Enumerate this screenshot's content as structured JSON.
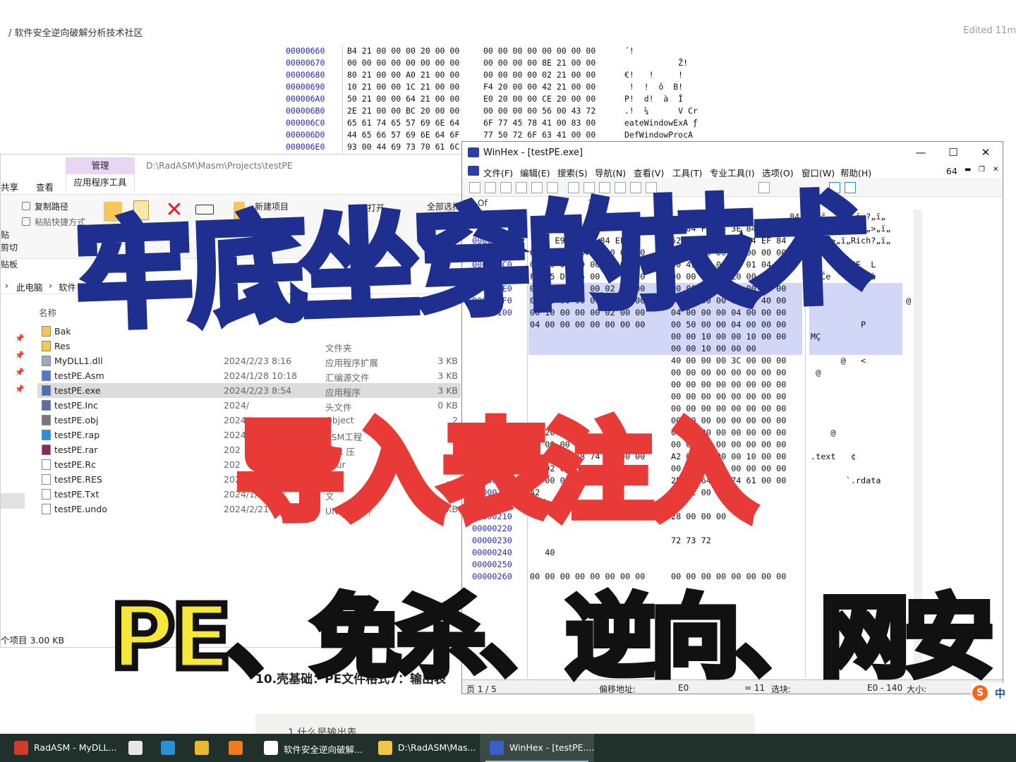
{
  "notion": {
    "breadcrumb": "/  软件安全逆向破解分析技术社区",
    "edited": "Edited 11m",
    "heading": "10.壳基础：PE文件格式7：输出表",
    "block_text": "1.什么是输出表",
    "hex_rows": [
      {
        "off": "00000660",
        "b1": "B4 21 00 00 00 20 00 00",
        "b2": "00 00 00 00 00 00 00 00",
        "asc": "´!"
      },
      {
        "off": "00000670",
        "b1": "00 00 00 00 00 00 00 00",
        "b2": "00 00 00 00 8E 21 00 00",
        "asc": "           Ž!"
      },
      {
        "off": "00000680",
        "b1": "80 21 00 00 A0 21 00 00",
        "b2": "00 00 00 00 02 21 00 00",
        "asc": "€!   !     !"
      },
      {
        "off": "00000690",
        "b1": "10 21 00 00 1C 21 00 00",
        "b2": "F4 20 00 00 42 21 00 00",
        "asc": " !  !  ô  B!"
      },
      {
        "off": "000006A0",
        "b1": "50 21 00 00 64 21 00 00",
        "b2": "E0 20 00 00 CE 20 00 00",
        "asc": "P!  d!  à  Î"
      },
      {
        "off": "000006B0",
        "b1": "2E 21 00 00 BC 20 00 00",
        "b2": "00 00 00 00 56 00 43 72",
        "asc": ".!  ¼      V Cr"
      },
      {
        "off": "000006C0",
        "b1": "65 61 74 65 57 69 6E 64",
        "b2": "6F 77 45 78 41 00 83 00",
        "asc": "eateWindowExA ƒ"
      },
      {
        "off": "000006D0",
        "b1": "44 65 66 57 69 6E 64 6F",
        "b2": "77 50 72 6F 63 41 00 00",
        "asc": "DefWindowProcA"
      },
      {
        "off": "000006E0",
        "b1": "93 00 44 69 73 70 61 6C",
        "b2": "",
        "asc": ""
      }
    ]
  },
  "explorer": {
    "manage_tab": "管理",
    "apptools_tab": "应用程序工具",
    "path_title": "D:\\RadASM\\Masm\\Projects\\testPE",
    "share_tab": "共享",
    "view_tab": "查看",
    "copy_path": "复制路径",
    "paste_shortcut": "粘贴快捷方式",
    "new_item": "新建项目",
    "move_to": "移动",
    "open_label": "打开",
    "select_all": "全部选择",
    "paste_partial": "贴",
    "cut_partial": "剪切",
    "clipboard_partial": "贴板",
    "addr_pc": "此电脑",
    "addr_soft": "软件",
    "col_name": "名称",
    "status": "个项目   3.00 KB",
    "files": [
      {
        "name": "Bak",
        "date": "",
        "type": "",
        "size": "",
        "icon": "folder",
        "sel": false
      },
      {
        "name": "Res",
        "date": "",
        "type": "文件夹",
        "size": "",
        "icon": "folder",
        "sel": false
      },
      {
        "name": "MyDLL1.dll",
        "date": "2024/2/23 8:16",
        "type": "应用程序扩展",
        "size": "3 KB",
        "icon": "dll",
        "sel": false
      },
      {
        "name": "testPE.Asm",
        "date": "2024/1/28 10:18",
        "type": "汇编源文件",
        "size": "3 KB",
        "icon": "asm",
        "sel": false
      },
      {
        "name": "testPE.exe",
        "date": "2024/2/23 8:54",
        "type": "应用程序",
        "size": "3 KB",
        "icon": "exe",
        "sel": true
      },
      {
        "name": "testPE.Inc",
        "date": "2024/",
        "type": "头文件",
        "size": "0 KB",
        "icon": "inc",
        "sel": false
      },
      {
        "name": "testPE.obj",
        "date": "2024/",
        "type": "Object",
        "size": "2",
        "icon": "obj",
        "sel": false
      },
      {
        "name": "testPE.rap",
        "date": "2024/",
        "type": "ASM工程",
        "size": "2",
        "icon": "rap",
        "sel": false
      },
      {
        "name": "testPE.rar",
        "date": "202",
        "type": "RAR 压",
        "size": "1",
        "icon": "rar",
        "sel": false
      },
      {
        "name": "testPE.Rc",
        "date": "202",
        "type": "Sour",
        "size": "0",
        "icon": "file",
        "sel": false
      },
      {
        "name": "testPE.RES",
        "date": "2024/1/",
        "type": "RE",
        "size": "",
        "icon": "file",
        "sel": false
      },
      {
        "name": "testPE.Txt",
        "date": "2024/1/28 10:",
        "type": "文",
        "size": "",
        "icon": "file",
        "sel": false
      },
      {
        "name": "testPE.undo",
        "date": "2024/2/21 18:20",
        "type": "UNDO 文件",
        "size": "KB",
        "icon": "file",
        "sel": false
      }
    ]
  },
  "winhex": {
    "title": "WinHex - [testPE.exe]",
    "menu": [
      "文件(F)",
      "编辑(E)",
      "搜索(S)",
      "导航(N)",
      "查看(V)",
      "工具(T)",
      "专业工具(I)",
      "选项(O)",
      "窗口(W)",
      "帮助(H)"
    ],
    "menu_right": "64",
    "tab_off": "Of",
    "tab_num": "3",
    "rows": [
      {
        "off": "",
        "h1": "   1 D",
        "h2": "         F",
        "asc": "ïèč„,ï„?„ï„?„ï„",
        "hl": false,
        "hex_tail": "84"
      },
      {
        "off": "",
        "h1": "   C 8",
        "h2": "EF 84 FD 84 3E 84 EF 84",
        "asc": "±›ü„,„ï„Ãÿý„>„ï„",
        "hl": false
      },
      {
        "off": "000000A0",
        "h1": "  82 E9 84 3E 84 EF 84",
        "h2": "52 69 63 68 3F 84 EF 84",
        "asc": "ø,é„>„ï„Rich?„ï„",
        "hl": false
      },
      {
        "off": "000000B0",
        "h1": "00 00 00 00 00 00 00 00",
        "h2": "00 00 00 00 00 00 00 00",
        "asc": "",
        "hl": false
      },
      {
        "off": "000000C0",
        "h1": "00 00 00 00 00 00 00 00",
        "h2": "50 45 00 00 4C 01 04 00",
        "asc": "        PE  L",
        "hl": false
      },
      {
        "off": "000000D0",
        "h1": "F2 65 D0 65 00 00 00 00",
        "h2": "00 00 00 00 E0 00 0F 01",
        "asc": "òeČe        à",
        "hl": false
      },
      {
        "off": "000000E0",
        "h1": "0B 01 05 0C 00 02 00 00",
        "h2": "00 06 00 00 00 00 00 00",
        "asc": "",
        "hl": true
      },
      {
        "off": "000000F0",
        "h1": "00 10 00 00 00 10 00 00",
        "h2": "00 20 00 00 00 00 40 00",
        "asc": "                   @",
        "hl": true
      },
      {
        "off": "00000100",
        "h1": "00 10 00 00 00 02 00 00",
        "h2": "04 00 00 00 04 00 00 00",
        "asc": "",
        "hl": true
      },
      {
        "off": "",
        "h1": "04 00 00 00 00 00 00 00",
        "h2": "00 50 00 00 04 00 00 00",
        "asc": "          P",
        "hl": true
      },
      {
        "off": "",
        "h1": "",
        "h2": "00 00 10 00 00 10 00 00",
        "asc": "MÇ",
        "hl": true
      },
      {
        "off": "",
        "h1": "",
        "h2": "00 00 10 00 00 00",
        "asc": "",
        "hl": true
      },
      {
        "off": "",
        "h1": "",
        "h2": "40 00 00 00 3C 00 00 00",
        "asc": "      @   <",
        "hl": false
      },
      {
        "off": "",
        "h1": "",
        "h2": "00 00 00 00 00 00 00 00",
        "asc": " @",
        "hl": false
      },
      {
        "off": "",
        "h1": "",
        "h2": "00 00 00 00 00 00 00 00",
        "asc": "",
        "hl": false
      },
      {
        "off": "",
        "h1": "",
        "h2": "00 00 00 00 00 00 00 00",
        "asc": "",
        "hl": false
      },
      {
        "off": "",
        "h1": "",
        "h2": "00 00 00 00 00 00 00 00",
        "asc": "",
        "hl": false
      },
      {
        "off": "",
        "h1": "",
        "h2": "00 00 00 00 00 00 00 00",
        "asc": "",
        "hl": false
      },
      {
        "off": "000001A0",
        "h1": "00 20",
        "h2": "00 00 00 00 00 00 00 00",
        "asc": "    @",
        "hl": false
      },
      {
        "off": "000001B0",
        "h1": "00 00 00 00 00 00 00 00",
        "h2": "00 00 00 00 00 00 00 00",
        "asc": "",
        "hl": false
      },
      {
        "off": "000001C0",
        "h1": "2E 74 65 78 74 00 00 00",
        "h2": "A2 01 00 00 00 10 00 00",
        "asc": ".text   ¢",
        "hl": false
      },
      {
        "off": "000001D0",
        "h1": "00 02 00 00 00 04 00 00",
        "h2": "00 00 00 00 00 00 00 00",
        "asc": "",
        "hl": false
      },
      {
        "off": "000001E0",
        "h1": "00 00 00 00 20 00 00 60",
        "h2": "2E 72 64 61 74 61 00 00",
        "asc": "       `.rdata",
        "hl": false
      },
      {
        "off": "000001F0",
        "h1": "A2",
        "h2": "00 02 00 00",
        "asc": "",
        "hl": false
      },
      {
        "off": "00000200",
        "h1": "",
        "h2": "",
        "asc": "",
        "hl": false
      },
      {
        "off": "00000210",
        "h1": "",
        "h2": "28 00 00 00",
        "asc": "",
        "hl": false
      },
      {
        "off": "00000220",
        "h1": "",
        "h2": "",
        "asc": "",
        "hl": false
      },
      {
        "off": "00000230",
        "h1": "",
        "h2": "72 73 72",
        "asc": "",
        "hl": false
      },
      {
        "off": "00000240",
        "h1": "   40",
        "h2": "",
        "asc": "",
        "hl": false
      },
      {
        "off": "00000250",
        "h1": "",
        "h2": "",
        "asc": "",
        "hl": false
      },
      {
        "off": "00000260",
        "h1": "00 00 00 00 00 00 00 00",
        "h2": "00 00 00 00 00 00 00 00",
        "asc": "",
        "hl": false
      }
    ],
    "status_page": "页 1 / 5",
    "status_offset_label": "偏移地址:",
    "status_offset": "E0",
    "status_eq": "= 11",
    "status_sel_label": "选块:",
    "status_sel": "E0 - 140",
    "status_size_label": "大小:"
  },
  "overlay": {
    "title": "牢底坐穿的技术",
    "subtitle": "导入表注入",
    "tags": "PE、免杀、逆向、网安"
  },
  "ime": {
    "label": "中"
  },
  "taskbar": [
    {
      "label": "RadASM - MyDLL...",
      "color": "#d23a2a"
    },
    {
      "label": "",
      "color": "#e7e7e7"
    },
    {
      "label": "",
      "color": "#2a8fd8"
    },
    {
      "label": "",
      "color": "#e8b92a"
    },
    {
      "label": "",
      "color": "#f07a1e"
    },
    {
      "label": "软件安全逆向破解...",
      "color": "#ffffff"
    },
    {
      "label": "D:\\RadASM\\Mas...",
      "color": "#f1c44a"
    },
    {
      "label": "WinHex - [testPE....",
      "color": "#3a5fc8"
    }
  ]
}
